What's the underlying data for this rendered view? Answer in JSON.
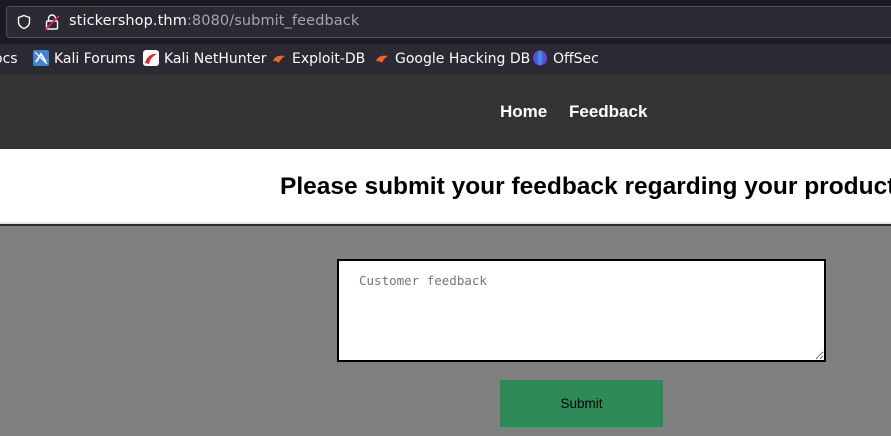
{
  "browser": {
    "url_host": "stickershop.thm",
    "url_rest": ":8080/submit_feedback",
    "bookmarks": [
      {
        "label": "ocs"
      },
      {
        "label": "Kali Forums",
        "icon": "kali-forums-icon"
      },
      {
        "label": "Kali NetHunter",
        "icon": "kali-nethunter-icon"
      },
      {
        "label": "Exploit-DB",
        "icon": "exploit-db-icon"
      },
      {
        "label": "Google Hacking DB",
        "icon": "google-hacking-db-icon"
      },
      {
        "label": "OffSec",
        "icon": "offsec-icon"
      }
    ]
  },
  "nav": {
    "home": "Home",
    "feedback": "Feedback"
  },
  "page": {
    "title": "Please submit your feedback regarding your product",
    "textarea_placeholder": "Customer feedback",
    "submit_label": "Submit"
  },
  "colors": {
    "nav_bg": "#333333",
    "content_bg": "#808080",
    "submit_bg": "#2e8b57"
  }
}
